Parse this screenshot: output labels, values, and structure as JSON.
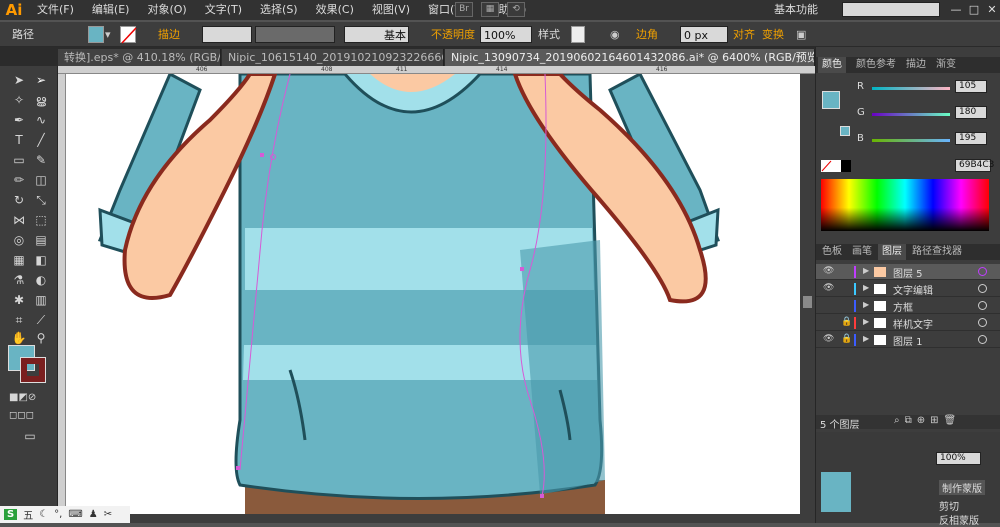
{
  "app": {
    "logo": "Ai"
  },
  "menu": [
    "文件(F)",
    "编辑(E)",
    "对象(O)",
    "文字(T)",
    "选择(S)",
    "效果(C)",
    "视图(V)",
    "窗口(W)",
    "帮助(H)"
  ],
  "menu_right": {
    "bridge_label": "Br",
    "workspace": "基本功能",
    "win_min": "—",
    "win_max": "□",
    "win_close": "✕"
  },
  "control": {
    "path_label": "路径",
    "stroke_label": "描边",
    "stroke_weight_label": "基本",
    "opacity_label": "不透明度",
    "opacity_value": "100%",
    "style_label": "样式",
    "corner_label": "边角",
    "corner_value": "0 px",
    "align_label": "对齐",
    "transform_label": "变换",
    "fill_color": "#69b4c3"
  },
  "tabs": [
    {
      "label": "转换].eps* @ 410.18% (RGB/...",
      "close": "×"
    },
    {
      "label": "Nipic_10615140_20191021092322666676.ai*",
      "close": "×"
    },
    {
      "label": "Nipic_13090734_20190602164601432086.ai* @ 6400% (RGB/预览)",
      "close": "×"
    }
  ],
  "ruler_ticks": [
    "406",
    "408",
    "411",
    "414",
    "416"
  ],
  "panels": {
    "color_tabs": [
      "颜色",
      "颜色参考",
      "描边",
      "渐变"
    ],
    "r_label": "R",
    "r_value": "105",
    "g_label": "G",
    "g_value": "180",
    "b_label": "B",
    "b_value": "195",
    "hex_value": "69B4C3",
    "layer_tabs": [
      "色板",
      "画笔",
      "图层",
      "路径查找器"
    ],
    "layers": [
      {
        "name": "图层 5",
        "color": "#c03cff",
        "locked": false,
        "visible": true
      },
      {
        "name": "文字编辑",
        "color": "#3cc9ff",
        "locked": false,
        "visible": true
      },
      {
        "name": "方框",
        "color": "#3c5cff",
        "locked": false,
        "visible": false
      },
      {
        "name": "样机文字",
        "color": "#ff3c3c",
        "locked": true,
        "visible": false
      },
      {
        "name": "图层 1",
        "color": "#3c5cff",
        "locked": true,
        "visible": true
      }
    ],
    "layers_count": "5 个图层",
    "opacity_mini": "100%",
    "bottom_labels": [
      "剪切",
      "反相蒙版"
    ],
    "make_mask": "制作蒙版"
  },
  "colors": {
    "shirt": "#69b4c3",
    "shirt_dark": "#4a9aab",
    "stripe": "#a2e0ea",
    "skin": "#fbc9a3",
    "outline": "#8a2a1e",
    "path_guide": "#d65ad6"
  },
  "taskbar": {
    "ime": "S",
    "mode": "五"
  }
}
